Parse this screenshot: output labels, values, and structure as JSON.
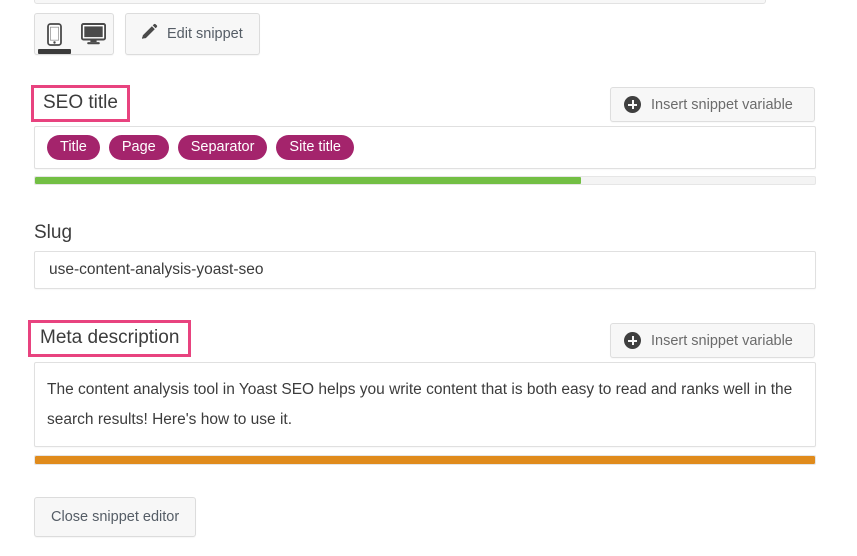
{
  "toolbar": {
    "device_toggle": {
      "mobile_label": "mobile-preview",
      "desktop_label": "desktop-preview",
      "active": "mobile"
    },
    "edit_snippet_label": "Edit snippet"
  },
  "seo_title": {
    "label": "SEO title",
    "insert_button_label": "Insert snippet variable",
    "variables": [
      {
        "label": "Title"
      },
      {
        "label": "Page"
      },
      {
        "label": "Separator"
      },
      {
        "label": "Site title"
      }
    ],
    "score_bar": {
      "fill_percent": 70,
      "color": "#73bf44",
      "track_color": "#f4f4f4"
    }
  },
  "slug": {
    "label": "Slug",
    "value": "use-content-analysis-yoast-seo"
  },
  "meta_description": {
    "label": "Meta description",
    "insert_button_label": "Insert snippet variable",
    "value": "The content analysis tool in Yoast SEO helps you write content that is both easy to read and ranks well in the search results! Here's how to use it.",
    "score_bar": {
      "fill_percent": 100,
      "color": "#e08b1c",
      "track_color": "#f4f4f4"
    }
  },
  "footer": {
    "close_label": "Close snippet editor"
  },
  "colors": {
    "highlight_outline": "#e8437f",
    "pill_background": "#a4246c",
    "good_score": "#73bf44",
    "ok_score": "#e08b1c",
    "text": "#3c3c3c"
  }
}
